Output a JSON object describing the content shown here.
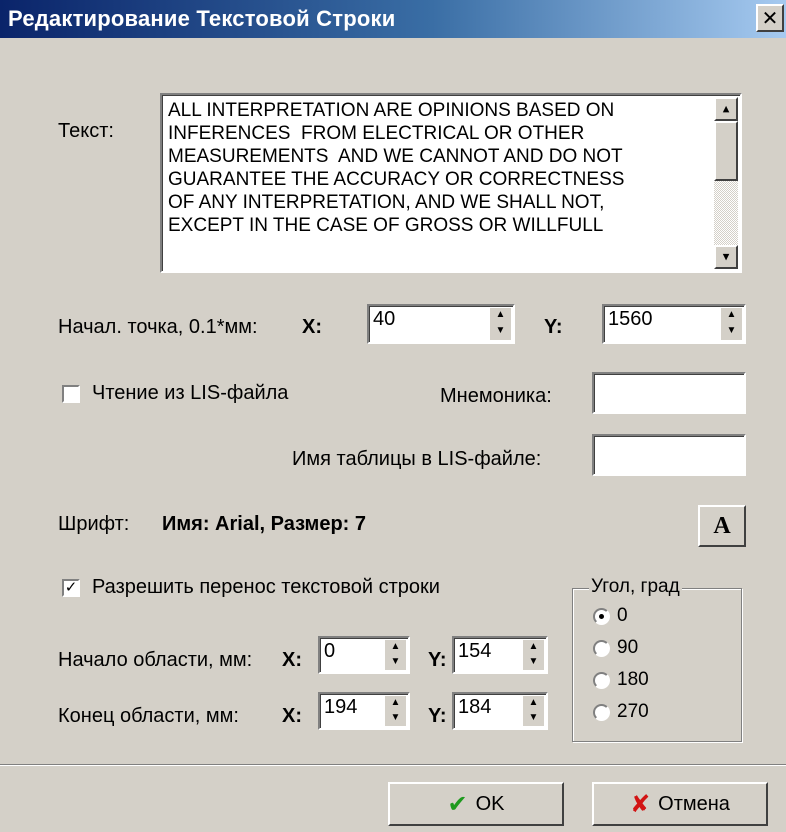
{
  "window": {
    "title": "Редактирование Текстовой Строки",
    "close_glyph": "✕"
  },
  "text": {
    "label": "Текст:",
    "value": "ALL INTERPRETATION ARE OPINIONS BASED ON\nINFERENCES  FROM ELECTRICAL OR OTHER\nMEASUREMENTS  AND WE CANNOT AND DO NOT\nGUARANTEE THE ACCURACY OR CORRECTNESS\nOF ANY INTERPRETATION, AND WE SHALL NOT,\nEXCEPT IN THE CASE OF GROSS OR WILLFULL"
  },
  "start_point": {
    "label": "Начал. точка, 0.1*мм:",
    "x_label": "X:",
    "x_value": "40",
    "y_label": "Y:",
    "y_value": "1560"
  },
  "lis": {
    "checkbox_label": "Чтение из LIS-файла",
    "checked": false,
    "mnemonic_label": "Мнемоника:",
    "mnemonic_value": "",
    "table_label": "Имя таблицы в LIS-файле:",
    "table_value": ""
  },
  "font": {
    "label": "Шрифт:",
    "description": "Имя: Arial, Размер: 7",
    "button_glyph": "A"
  },
  "wrap": {
    "checkbox_label": "Разрешить перенос текстовой строки",
    "checked": true,
    "checkmark": "✓"
  },
  "area_start": {
    "label": "Начало области, мм:",
    "x_label": "X:",
    "x_value": "0",
    "y_label": "Y:",
    "y_value": "154"
  },
  "area_end": {
    "label": "Конец области, мм:",
    "x_label": "X:",
    "x_value": "194",
    "y_label": "Y:",
    "y_value": "184"
  },
  "angle": {
    "title": "Угол, град",
    "options": [
      "0",
      "90",
      "180",
      "270"
    ],
    "selected": "0"
  },
  "buttons": {
    "ok_label": "OK",
    "ok_icon": "✔",
    "cancel_label": "Отмена",
    "cancel_icon": "✘"
  }
}
